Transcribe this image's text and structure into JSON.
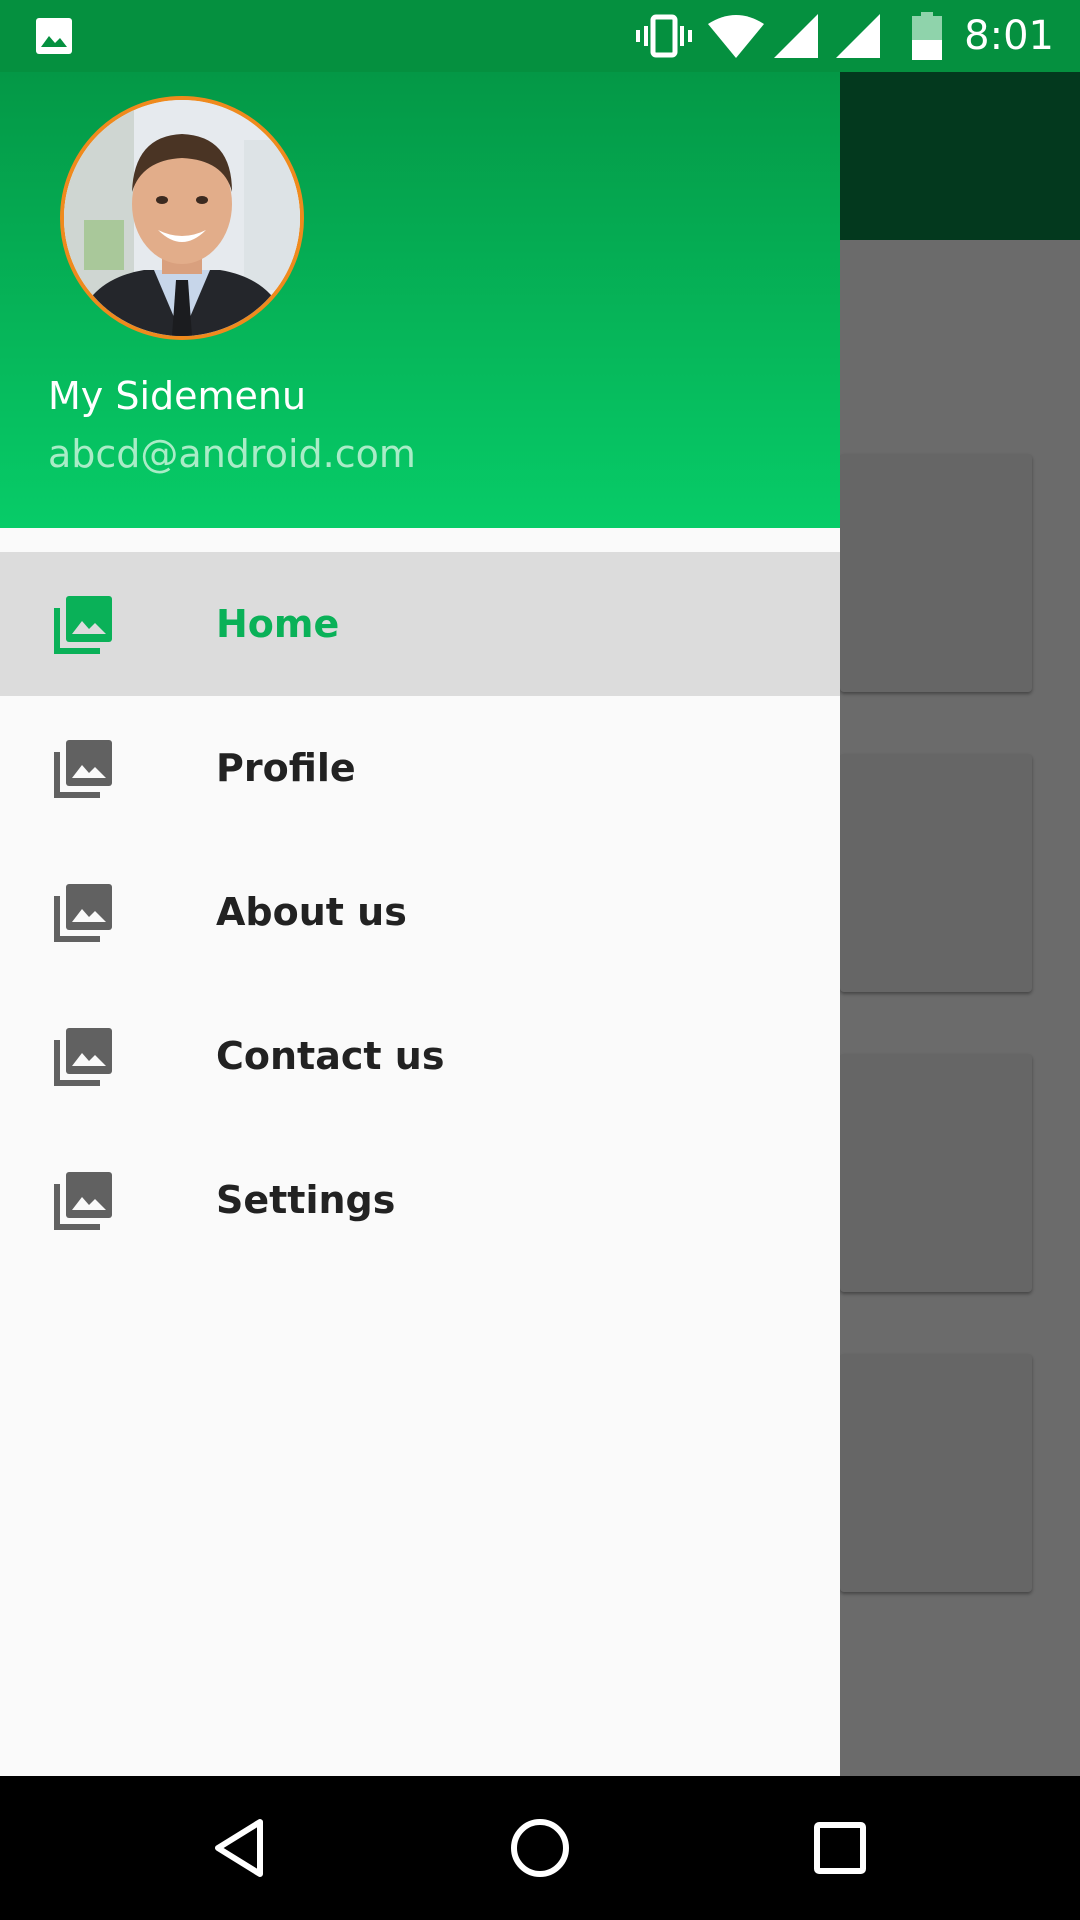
{
  "status_bar": {
    "time": "8:01",
    "icons": [
      "gallery-notification-icon",
      "vibrate-icon",
      "wifi-icon",
      "cell-signal-icon",
      "cell-signal-icon",
      "battery-icon"
    ]
  },
  "drawer": {
    "header": {
      "name": "My Sidemenu",
      "email": "abcd@android.com",
      "gradient_top": "#049846",
      "gradient_bottom": "#07cc68",
      "avatar_border_color": "#ef8a1d"
    },
    "menu_items": [
      {
        "label": "Home",
        "icon": "photo-library-icon",
        "active": true
      },
      {
        "label": "Profile",
        "icon": "photo-library-icon",
        "active": false
      },
      {
        "label": "About us",
        "icon": "photo-library-icon",
        "active": false
      },
      {
        "label": "Contact us",
        "icon": "photo-library-icon",
        "active": false
      },
      {
        "label": "Settings",
        "icon": "photo-library-icon",
        "active": false
      }
    ],
    "accent_color": "#0ab158",
    "inactive_icon_color": "#616161"
  },
  "nav_bar": {
    "buttons": [
      "back-icon",
      "home-icon",
      "recents-icon"
    ]
  }
}
